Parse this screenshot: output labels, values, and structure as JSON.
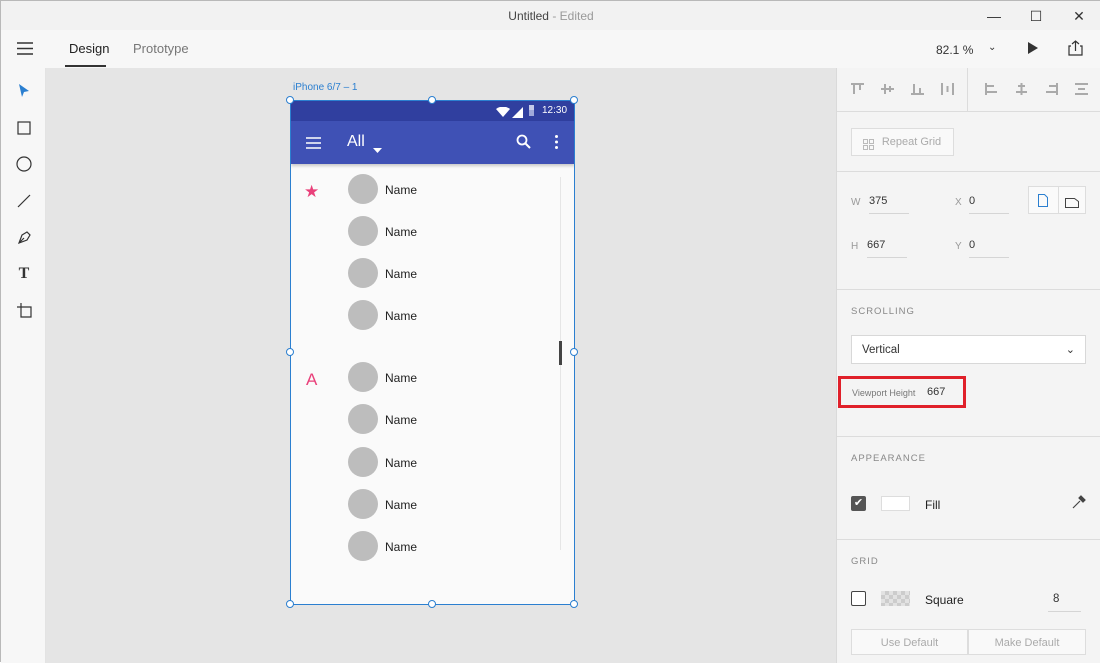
{
  "window": {
    "title": "Untitled",
    "title_suffix": "- Edited",
    "minimize": "—",
    "maximize": "☐",
    "close": "✕"
  },
  "toolbar": {
    "tabs": [
      {
        "label": "Design",
        "active": true
      },
      {
        "label": "Prototype",
        "active": false
      }
    ],
    "zoom": "82.1 %"
  },
  "artboard": {
    "name": "iPhone 6/7 – 1",
    "status_time": "12:30",
    "appbar_title": "All",
    "sections": [
      {
        "marker": "★",
        "items": [
          "Name",
          "Name",
          "Name",
          "Name"
        ]
      },
      {
        "marker": "A",
        "items": [
          "Name",
          "Name",
          "Name",
          "Name",
          "Name"
        ]
      }
    ]
  },
  "panel": {
    "repeat_grid": "Repeat Grid",
    "w_label": "W",
    "w": "375",
    "x_label": "X",
    "x": "0",
    "h_label": "H",
    "h": "667",
    "y_label": "Y",
    "y": "0",
    "scrolling_label": "SCROLLING",
    "scrolling_value": "Vertical",
    "viewport_label": "Viewport Height",
    "viewport_value": "667",
    "appearance_label": "APPEARANCE",
    "fill_label": "Fill",
    "fill_checked": true,
    "grid_label": "GRID",
    "grid_type": "Square",
    "grid_size": "8",
    "grid_checked": false,
    "use_default": "Use Default",
    "make_default": "Make Default"
  },
  "colors": {
    "accent": "#2b7fd0",
    "appbar": "#3f51b5",
    "statusbar": "#303f9f",
    "pink": "#e9407a",
    "highlight": "#e0202a"
  }
}
